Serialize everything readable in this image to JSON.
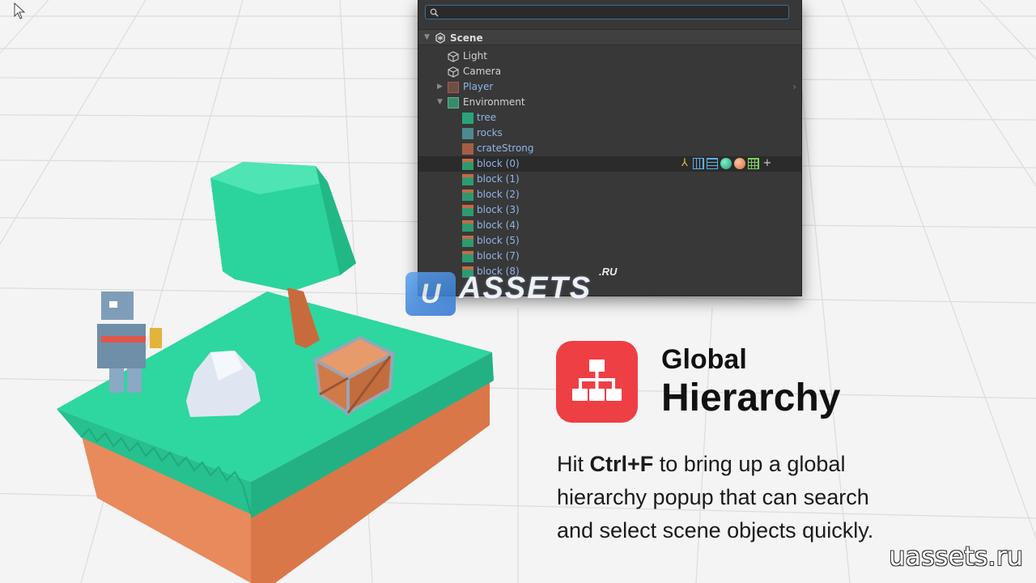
{
  "hierarchy": {
    "search_placeholder": "",
    "scene_label": "Scene",
    "items": [
      {
        "label": "Light",
        "icon": "gameobject-icon"
      },
      {
        "label": "Camera",
        "icon": "gameobject-icon"
      },
      {
        "label": "Player",
        "icon": "prefab-icon",
        "collapsed": true
      },
      {
        "label": "Environment",
        "icon": "prefab-icon",
        "expanded": true
      },
      {
        "label": "tree",
        "icon": "tree-mesh-icon"
      },
      {
        "label": "rocks",
        "icon": "rocks-mesh-icon"
      },
      {
        "label": "crateStrong",
        "icon": "crate-mesh-icon"
      },
      {
        "label": "block (0)",
        "icon": "block-mesh-icon",
        "selected": true
      },
      {
        "label": "block (1)",
        "icon": "block-mesh-icon"
      },
      {
        "label": "block (2)",
        "icon": "block-mesh-icon"
      },
      {
        "label": "block (3)",
        "icon": "block-mesh-icon"
      },
      {
        "label": "block (4)",
        "icon": "block-mesh-icon"
      },
      {
        "label": "block (5)",
        "icon": "block-mesh-icon"
      },
      {
        "label": "block (7)",
        "icon": "block-mesh-icon"
      },
      {
        "label": "block (8)",
        "icon": "block-mesh-icon"
      }
    ],
    "component_icons": [
      "transform-icon",
      "mesh-filter-icon",
      "mesh-renderer-icon",
      "material-green-icon",
      "material-orange-icon",
      "grid-icon",
      "add-component-icon"
    ]
  },
  "watermark": {
    "badge_letter": "U",
    "brand": "ASSETS",
    "tld": ".RU",
    "site": "uassets.ru"
  },
  "feature": {
    "title_line1": "Global",
    "title_line2": "Hierarchy",
    "desc_prefix": "Hit ",
    "desc_shortcut": "Ctrl+F",
    "desc_line1_rest": " to bring up a global",
    "desc_line2": "hierarchy popup that can search",
    "desc_line3": "and select scene objects quickly.",
    "icon": "hierarchy-tree-icon"
  },
  "colors": {
    "accent_red": "#ee3f45",
    "popup_bg": "#383838",
    "selection_blue_text": "#8fb4e8",
    "grass": "#2ed6a0",
    "dirt": "#e88a5b"
  }
}
